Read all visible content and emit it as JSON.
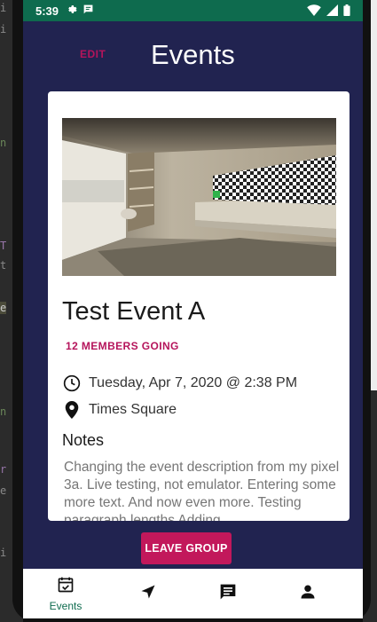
{
  "status_bar": {
    "time": "5:39",
    "icons_left": [
      "gear-icon",
      "message-icon"
    ],
    "icons_right": [
      "wifi-icon",
      "signal-icon",
      "battery-icon"
    ],
    "color": "#0e6b4e"
  },
  "header": {
    "edit_label": "EDIT",
    "title": "Events"
  },
  "event": {
    "name": "Test Event A",
    "members": "12 MEMBERS GOING",
    "datetime": "Tuesday, Apr 7, 2020 @ 2:38 PM",
    "location": "Times Square",
    "notes_heading": "Notes",
    "notes": "Changing the event description from my pixel 3a. Live testing, not emulator. Entering some more text.  And now even more. Testing paragraph lengths Adding"
  },
  "actions": {
    "leave_label": "LEAVE GROUP"
  },
  "bottom_nav": {
    "items": [
      {
        "label": "Events",
        "icon": "calendar-check-icon",
        "active": true
      },
      {
        "label": "",
        "icon": "navigation-arrow-icon",
        "active": false
      },
      {
        "label": "",
        "icon": "chat-icon",
        "active": false
      },
      {
        "label": "",
        "icon": "person-icon",
        "active": false
      }
    ]
  },
  "colors": {
    "background": "#212350",
    "accent": "#c2185b",
    "status_bar": "#0e6b4e",
    "card": "#ffffff"
  }
}
